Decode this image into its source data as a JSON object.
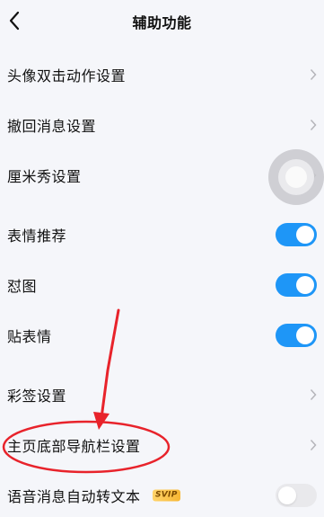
{
  "header": {
    "title": "辅助功能",
    "back_icon": "chevron-left-icon"
  },
  "settings": [
    {
      "label": "头像双击动作设置",
      "control": "chevron"
    },
    {
      "label": "撤回消息设置",
      "control": "chevron"
    },
    {
      "label": "厘米秀设置",
      "control": "chevron"
    },
    {
      "label": "表情推荐",
      "control": "toggle",
      "on": true
    },
    {
      "label": "怼图",
      "control": "toggle",
      "on": true
    },
    {
      "label": "贴表情",
      "control": "toggle",
      "on": true
    },
    {
      "label": "彩签设置",
      "control": "chevron"
    },
    {
      "label": "主页底部导航栏设置",
      "control": "chevron"
    },
    {
      "label": "语音消息自动转文本",
      "badge": "SVIP",
      "control": "toggle",
      "on": false
    }
  ],
  "colors": {
    "accent": "#1e96f7",
    "annotation": "#e8232b",
    "background": "#f5f6fa"
  }
}
